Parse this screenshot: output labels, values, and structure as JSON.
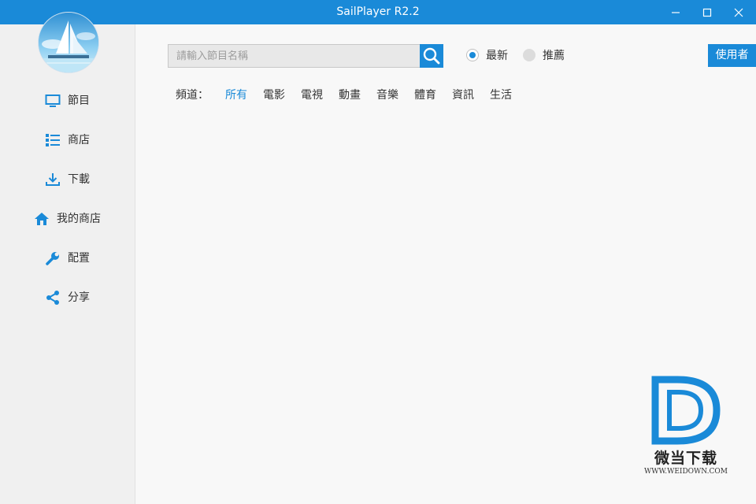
{
  "window": {
    "title": "SailPlayer  R2.2",
    "accent_color": "#1a8ad8",
    "controls": [
      "minimize-icon",
      "maximize-icon",
      "close-icon"
    ]
  },
  "sidebar": {
    "items": [
      {
        "label": "節目",
        "icon": "monitor-icon"
      },
      {
        "label": "商店",
        "icon": "list-icon"
      },
      {
        "label": "下載",
        "icon": "download-icon"
      },
      {
        "label": "我的商店",
        "icon": "home-icon"
      },
      {
        "label": "配置",
        "icon": "wrench-icon"
      },
      {
        "label": "分享",
        "icon": "share-icon"
      }
    ]
  },
  "search": {
    "placeholder": "請輸入節目名稱",
    "value": "",
    "button_icon": "search-icon"
  },
  "sort": {
    "options": [
      {
        "label": "最新",
        "selected": true
      },
      {
        "label": "推薦",
        "selected": false
      }
    ]
  },
  "user_button": {
    "label": "使用者"
  },
  "channels": {
    "label": "頻道：",
    "items": [
      "所有",
      "電影",
      "電視",
      "動畫",
      "音樂",
      "體育",
      "資訊",
      "生活"
    ],
    "active": "所有"
  },
  "watermark": {
    "brand": "微当下载",
    "url": "WWW.WEIDOWN.COM",
    "logo_color": "#1a8ad8"
  }
}
